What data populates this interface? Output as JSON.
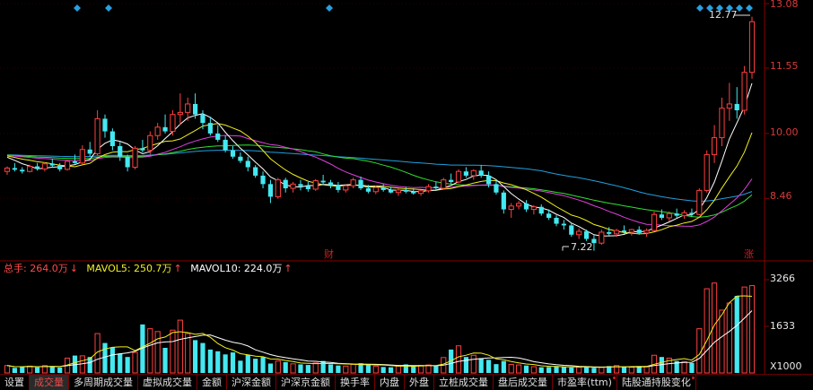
{
  "price_axis": {
    "ticks": [
      "13.08",
      "11.55",
      "10.00",
      "8.46"
    ],
    "ymin": 7.0,
    "ymax": 13.08
  },
  "annotations": {
    "high": "12.77",
    "low": "7.22",
    "event_left": "财",
    "event_right": "涨"
  },
  "volume_legend": {
    "total": "总手: 264.0万",
    "total_arrow": "↓",
    "mavol5": "MAVOL5: 250.7万",
    "mavol5_arrow": "↑",
    "mavol10": "MAVOL10: 224.0万",
    "mavol10_arrow": "↑"
  },
  "volume_axis": {
    "ticks": [
      "3266",
      "1633"
    ],
    "unit": "X1000",
    "ymax": 3266
  },
  "tabs": [
    {
      "label": "设置",
      "active": false,
      "sup": false
    },
    {
      "label": "成交量",
      "active": true,
      "sup": false
    },
    {
      "label": "多周期成交量",
      "active": false,
      "sup": false
    },
    {
      "label": "虚拟成交量",
      "active": false,
      "sup": false
    },
    {
      "label": "金额",
      "active": false,
      "sup": false
    },
    {
      "label": "沪深金额",
      "active": false,
      "sup": false
    },
    {
      "label": "沪深京金额",
      "active": false,
      "sup": false
    },
    {
      "label": "换手率",
      "active": false,
      "sup": false
    },
    {
      "label": "内盘",
      "active": false,
      "sup": false
    },
    {
      "label": "外盘",
      "active": false,
      "sup": false
    },
    {
      "label": "立桩成交量",
      "active": false,
      "sup": false
    },
    {
      "label": "盘后成交量",
      "active": false,
      "sup": false
    },
    {
      "label": "市盈率(ttm)",
      "active": false,
      "sup": true
    },
    {
      "label": "陆股通持股变化",
      "active": false,
      "sup": true
    }
  ],
  "colors": {
    "up": "#ff4040",
    "down": "#44e8f0",
    "ma5": "#ffffff",
    "ma10": "#f0f020",
    "ma20": "#e040e0",
    "ma30": "#30e030",
    "ma60": "#20a0e0",
    "grid": "#8a0000",
    "marker": "#28a0e0"
  },
  "chart_data": {
    "type": "candlestick",
    "series": [
      {
        "name": "price",
        "candles": [
          [
            9.1,
            9.22,
            9.02,
            9.18
          ],
          [
            9.18,
            9.3,
            9.1,
            9.14
          ],
          [
            9.14,
            9.2,
            9.05,
            9.1
          ],
          [
            9.1,
            9.26,
            9.08,
            9.22
          ],
          [
            9.22,
            9.3,
            9.12,
            9.16
          ],
          [
            9.16,
            9.32,
            9.1,
            9.28
          ],
          [
            9.28,
            9.4,
            9.2,
            9.24
          ],
          [
            9.24,
            9.3,
            9.1,
            9.15
          ],
          [
            9.15,
            9.38,
            9.12,
            9.34
          ],
          [
            9.34,
            9.5,
            9.28,
            9.3
          ],
          [
            9.3,
            9.72,
            9.26,
            9.62
          ],
          [
            9.62,
            9.8,
            9.45,
            9.52
          ],
          [
            9.52,
            10.55,
            9.48,
            10.35
          ],
          [
            10.35,
            10.45,
            9.9,
            10.05
          ],
          [
            10.05,
            10.12,
            9.6,
            9.7
          ],
          [
            9.7,
            9.8,
            9.35,
            9.45
          ],
          [
            9.45,
            9.5,
            9.1,
            9.2
          ],
          [
            9.2,
            9.7,
            9.15,
            9.65
          ],
          [
            9.65,
            9.85,
            9.55,
            9.6
          ],
          [
            9.6,
            10.05,
            9.5,
            9.95
          ],
          [
            9.95,
            10.25,
            9.85,
            10.15
          ],
          [
            10.15,
            10.45,
            10.0,
            10.05
          ],
          [
            10.05,
            10.55,
            9.95,
            10.45
          ],
          [
            10.45,
            10.95,
            10.2,
            10.5
          ],
          [
            10.5,
            10.85,
            10.3,
            10.7
          ],
          [
            10.7,
            10.95,
            10.35,
            10.45
          ],
          [
            10.45,
            10.55,
            10.1,
            10.25
          ],
          [
            10.25,
            10.4,
            9.95,
            10.0
          ],
          [
            10.0,
            10.2,
            9.8,
            9.85
          ],
          [
            9.85,
            9.95,
            9.55,
            9.6
          ],
          [
            9.6,
            9.7,
            9.4,
            9.45
          ],
          [
            9.45,
            9.55,
            9.3,
            9.35
          ],
          [
            9.35,
            9.45,
            9.1,
            9.2
          ],
          [
            9.2,
            9.25,
            8.95,
            9.0
          ],
          [
            9.0,
            9.1,
            8.7,
            8.8
          ],
          [
            8.8,
            8.9,
            8.35,
            8.5
          ],
          [
            8.5,
            8.95,
            8.45,
            8.9
          ],
          [
            8.9,
            8.95,
            8.6,
            8.7
          ],
          [
            8.7,
            8.85,
            8.6,
            8.8
          ],
          [
            8.8,
            8.9,
            8.65,
            8.75
          ],
          [
            8.75,
            8.85,
            8.62,
            8.68
          ],
          [
            8.68,
            8.92,
            8.64,
            8.88
          ],
          [
            8.88,
            9.02,
            8.78,
            8.84
          ],
          [
            8.84,
            8.9,
            8.7,
            8.78
          ],
          [
            8.78,
            8.85,
            8.6,
            8.66
          ],
          [
            8.66,
            8.8,
            8.6,
            8.76
          ],
          [
            8.76,
            8.95,
            8.7,
            8.9
          ],
          [
            8.9,
            8.98,
            8.66,
            8.7
          ],
          [
            8.7,
            8.78,
            8.58,
            8.62
          ],
          [
            8.62,
            8.76,
            8.56,
            8.72
          ],
          [
            8.72,
            8.8,
            8.62,
            8.66
          ],
          [
            8.66,
            8.74,
            8.58,
            8.6
          ],
          [
            8.6,
            8.7,
            8.52,
            8.66
          ],
          [
            8.66,
            8.74,
            8.58,
            8.62
          ],
          [
            8.62,
            8.7,
            8.55,
            8.58
          ],
          [
            8.58,
            8.66,
            8.52,
            8.64
          ],
          [
            8.64,
            8.8,
            8.6,
            8.74
          ],
          [
            8.74,
            8.86,
            8.66,
            8.7
          ],
          [
            8.7,
            8.95,
            8.68,
            8.9
          ],
          [
            8.9,
            9.05,
            8.8,
            8.85
          ],
          [
            8.85,
            9.15,
            8.82,
            9.1
          ],
          [
            9.1,
            9.2,
            8.95,
            9.0
          ],
          [
            9.0,
            9.15,
            8.9,
            9.12
          ],
          [
            9.12,
            9.25,
            8.95,
            9.0
          ],
          [
            9.0,
            9.1,
            8.72,
            8.8
          ],
          [
            8.8,
            8.9,
            8.55,
            8.6
          ],
          [
            8.6,
            8.65,
            8.1,
            8.2
          ],
          [
            8.2,
            8.35,
            8.0,
            8.28
          ],
          [
            8.28,
            8.4,
            8.2,
            8.34
          ],
          [
            8.34,
            8.42,
            8.14,
            8.2
          ],
          [
            8.2,
            8.3,
            8.08,
            8.26
          ],
          [
            8.26,
            8.32,
            8.05,
            8.1
          ],
          [
            8.1,
            8.2,
            7.95,
            8.0
          ],
          [
            8.0,
            8.06,
            7.8,
            7.86
          ],
          [
            7.86,
            7.95,
            7.72,
            7.82
          ],
          [
            7.82,
            7.88,
            7.55,
            7.6
          ],
          [
            7.6,
            7.75,
            7.5,
            7.68
          ],
          [
            7.68,
            7.72,
            7.45,
            7.5
          ],
          [
            7.5,
            7.6,
            7.22,
            7.4
          ],
          [
            7.4,
            7.72,
            7.36,
            7.66
          ],
          [
            7.66,
            7.78,
            7.58,
            7.62
          ],
          [
            7.62,
            7.74,
            7.55,
            7.7
          ],
          [
            7.7,
            7.82,
            7.62,
            7.66
          ],
          [
            7.66,
            7.74,
            7.58,
            7.72
          ],
          [
            7.72,
            7.8,
            7.6,
            7.64
          ],
          [
            7.64,
            7.75,
            7.55,
            7.7
          ],
          [
            7.7,
            8.15,
            7.68,
            8.08
          ],
          [
            8.08,
            8.2,
            7.95,
            8.0
          ],
          [
            8.0,
            8.15,
            7.92,
            8.1
          ],
          [
            8.1,
            8.22,
            8.0,
            8.05
          ],
          [
            8.05,
            8.18,
            7.98,
            8.12
          ],
          [
            8.12,
            8.22,
            8.02,
            8.08
          ],
          [
            8.08,
            8.7,
            8.06,
            8.65
          ],
          [
            8.65,
            9.6,
            8.6,
            9.5
          ],
          [
            9.5,
            10.2,
            9.3,
            9.9
          ],
          [
            9.9,
            10.85,
            9.7,
            10.6
          ],
          [
            10.6,
            11.2,
            10.3,
            10.7
          ],
          [
            10.7,
            11.1,
            10.35,
            10.55
          ],
          [
            10.55,
            11.6,
            10.45,
            11.45
          ],
          [
            11.45,
            12.77,
            11.3,
            12.65
          ]
        ]
      },
      {
        "name": "volume",
        "values": [
          260,
          180,
          220,
          240,
          200,
          260,
          230,
          190,
          520,
          610,
          600,
          560,
          1380,
          1050,
          900,
          680,
          560,
          720,
          1700,
          1550,
          1450,
          880,
          1500,
          1850,
          1380,
          1150,
          1050,
          820,
          760,
          650,
          720,
          430,
          630,
          500,
          560,
          330,
          420,
          380,
          320,
          300,
          280,
          350,
          420,
          300,
          260,
          240,
          300,
          340,
          300,
          240,
          210,
          200,
          240,
          300,
          230,
          260,
          280,
          240,
          540,
          820,
          950,
          560,
          620,
          520,
          460,
          310,
          420,
          300,
          280,
          260,
          220,
          200,
          210,
          240,
          220,
          190,
          200,
          220,
          180,
          200,
          240,
          260,
          210,
          200,
          240,
          230,
          620,
          560,
          520,
          420,
          400,
          350,
          1550,
          2950,
          3150,
          2200,
          2450,
          2700,
          3010,
          3060
        ]
      }
    ],
    "ylim": [
      7.0,
      13.08
    ]
  }
}
